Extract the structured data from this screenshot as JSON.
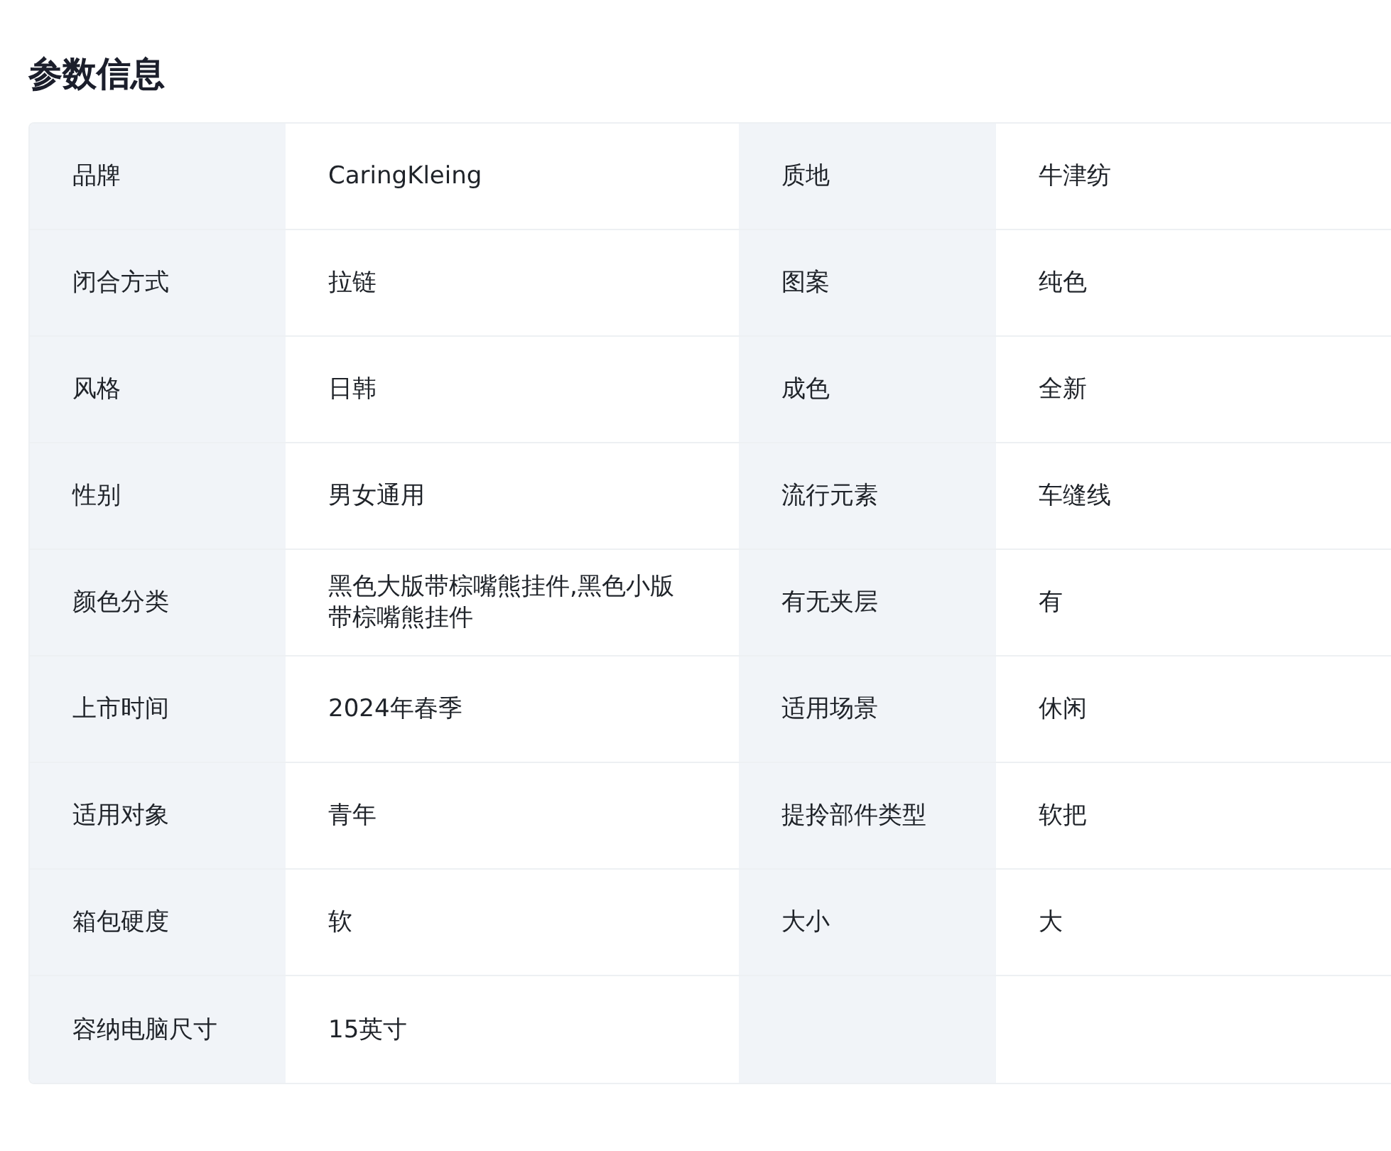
{
  "title": "参数信息",
  "params": [
    {
      "label": "品牌",
      "value": "CaringKleing"
    },
    {
      "label": "质地",
      "value": "牛津纺"
    },
    {
      "label": "闭合方式",
      "value": "拉链"
    },
    {
      "label": "图案",
      "value": "纯色"
    },
    {
      "label": "风格",
      "value": "日韩"
    },
    {
      "label": "成色",
      "value": "全新"
    },
    {
      "label": "性别",
      "value": "男女通用"
    },
    {
      "label": "流行元素",
      "value": "车缝线"
    },
    {
      "label": "颜色分类",
      "value": "黑色大版带棕嘴熊挂件,黑色小版带棕嘴熊挂件"
    },
    {
      "label": "有无夹层",
      "value": "有"
    },
    {
      "label": "上市时间",
      "value": "2024年春季"
    },
    {
      "label": "适用场景",
      "value": "休闲"
    },
    {
      "label": "适用对象",
      "value": "青年"
    },
    {
      "label": "提拎部件类型",
      "value": "软把"
    },
    {
      "label": "箱包硬度",
      "value": "软"
    },
    {
      "label": "大小",
      "value": "大"
    },
    {
      "label": "容纳电脑尺寸",
      "value": "15英寸"
    }
  ]
}
